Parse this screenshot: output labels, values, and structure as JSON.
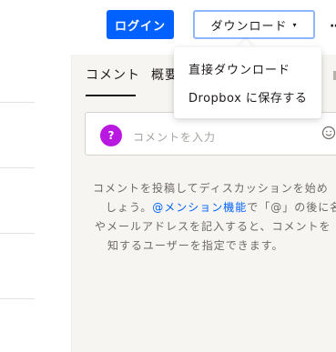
{
  "header": {
    "login_label": "ログイン",
    "download_label": "ダウンロード",
    "download_caret": "▾",
    "more_label": "··"
  },
  "download_menu": {
    "items": [
      {
        "label": "直接ダウンロード"
      },
      {
        "label": "Dropbox に保存する"
      }
    ]
  },
  "comments": {
    "tabs": [
      {
        "label": "コメント",
        "active": true
      },
      {
        "label": "概要",
        "active": false
      }
    ],
    "avatar_text": "?",
    "input_placeholder": "コメントを入力",
    "help_line1": "コメントを投稿してディスカッションを始め",
    "help_line2_prefix": "しょう。",
    "help_mention_link": "@メンション機能",
    "help_line2_suffix": "で「@」の後に名",
    "help_line3": "やメールアドレスを記入すると、コメントを",
    "help_line4": "知するユーザーを指定できます。"
  },
  "colors": {
    "brand_blue": "#0061fe",
    "avatar_purple": "#b818e0",
    "panel_bg": "#f7f5f2"
  },
  "icons": {
    "emoji": "emoji-smile-icon",
    "caret": "caret-down-icon",
    "more": "more-horizontal-icon"
  }
}
